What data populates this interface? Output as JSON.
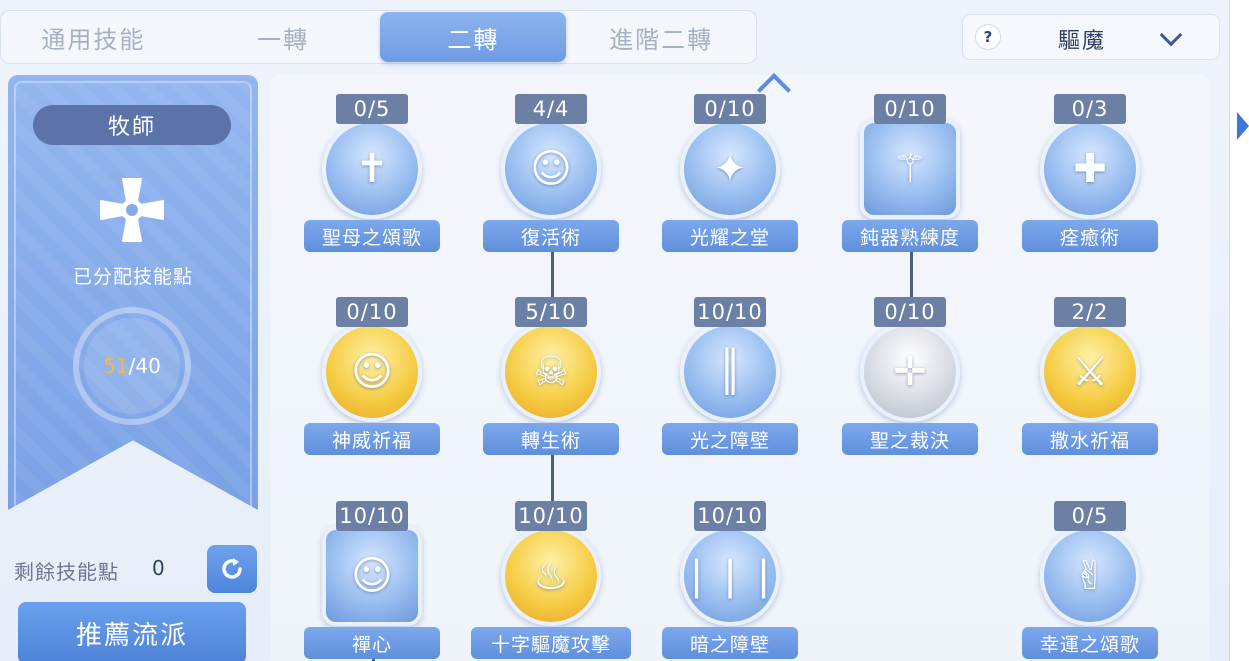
{
  "tabs": [
    {
      "label": "通用技能"
    },
    {
      "label": "一轉"
    },
    {
      "label": "二轉",
      "active": true
    },
    {
      "label": "進階二轉"
    }
  ],
  "build_dropdown": {
    "help": "?",
    "value": "驅魔"
  },
  "class_panel": {
    "class_name": "牧師",
    "allocated_label": "已分配技能點",
    "used": "51",
    "total": "/40"
  },
  "remaining": {
    "label": "剩餘技能點",
    "value": "0"
  },
  "recommend_label": "推薦流派",
  "skills": [
    {
      "name": "聖母之頌歌",
      "count": "0/5",
      "color": "blue",
      "icon": "praying-saint-icon"
    },
    {
      "name": "復活術",
      "count": "4/4",
      "color": "blue",
      "icon": "haloed-figure-icon"
    },
    {
      "name": "光耀之堂",
      "count": "0/10",
      "color": "blue",
      "icon": "crystal-hall-icon"
    },
    {
      "name": "鈍器熟練度",
      "count": "0/10",
      "color": "blue",
      "icon": "mace-icon"
    },
    {
      "name": "痊癒術",
      "count": "0/3",
      "color": "blue",
      "icon": "healing-figure-icon"
    },
    {
      "name": "神威祈福",
      "count": "0/10",
      "color": "gold",
      "icon": "blessed-face-icon"
    },
    {
      "name": "轉生術",
      "count": "5/10",
      "color": "gold",
      "icon": "skulls-icon"
    },
    {
      "name": "光之障壁",
      "count": "10/10",
      "color": "blue",
      "icon": "light-barrier-icon"
    },
    {
      "name": "聖之裁決",
      "count": "0/10",
      "color": "silver",
      "icon": "holy-cross-icon"
    },
    {
      "name": "撒水祈福",
      "count": "2/2",
      "color": "gold",
      "icon": "crossed-swords-icon"
    },
    {
      "name": "禪心",
      "count": "10/10",
      "color": "blue",
      "icon": "meditating-figure-icon"
    },
    {
      "name": "十字驅魔攻擊",
      "count": "10/10",
      "color": "gold",
      "icon": "holy-flame-icon"
    },
    {
      "name": "暗之障壁",
      "count": "10/10",
      "color": "blue",
      "icon": "dark-barrier-icon"
    },
    {
      "name": "幸運之頌歌",
      "count": "0/5",
      "color": "blue",
      "icon": "victory-hand-icon"
    }
  ]
}
